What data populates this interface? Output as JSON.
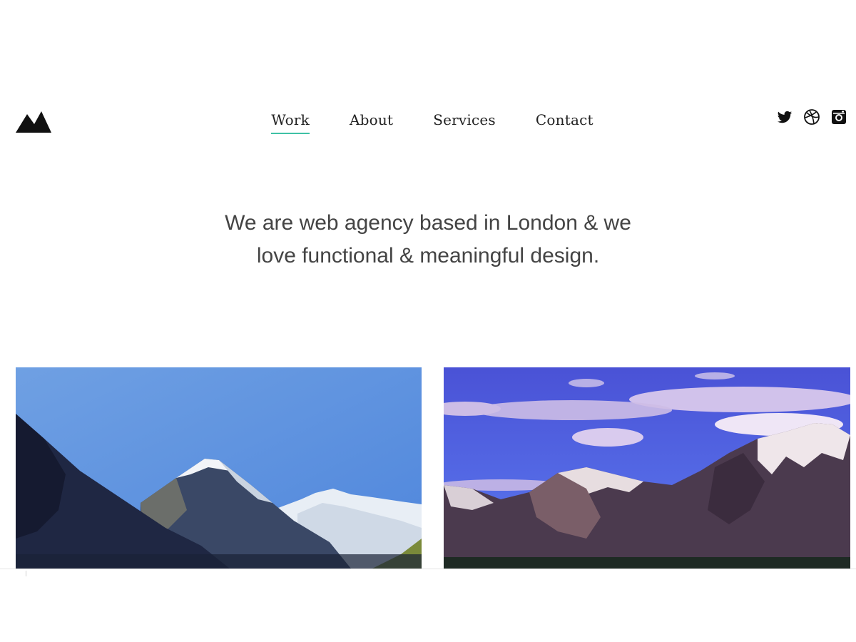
{
  "brand": {
    "logo_icon": "mountains-logo-icon"
  },
  "nav": {
    "items": [
      {
        "label": "Work",
        "active": true
      },
      {
        "label": "About",
        "active": false
      },
      {
        "label": "Services",
        "active": false
      },
      {
        "label": "Contact",
        "active": false
      }
    ],
    "active_underline_color": "#3fc1a5"
  },
  "social": {
    "icons": [
      "twitter-icon",
      "dribbble-icon",
      "instagram-icon"
    ]
  },
  "hero": {
    "line1": "We are web agency based in London & we",
    "line2": "love functional & meaningful design."
  },
  "gallery": {
    "images": [
      {
        "icon": "mountain-photo-clear-sky"
      },
      {
        "icon": "mountain-photo-cloudy-sky"
      }
    ]
  }
}
